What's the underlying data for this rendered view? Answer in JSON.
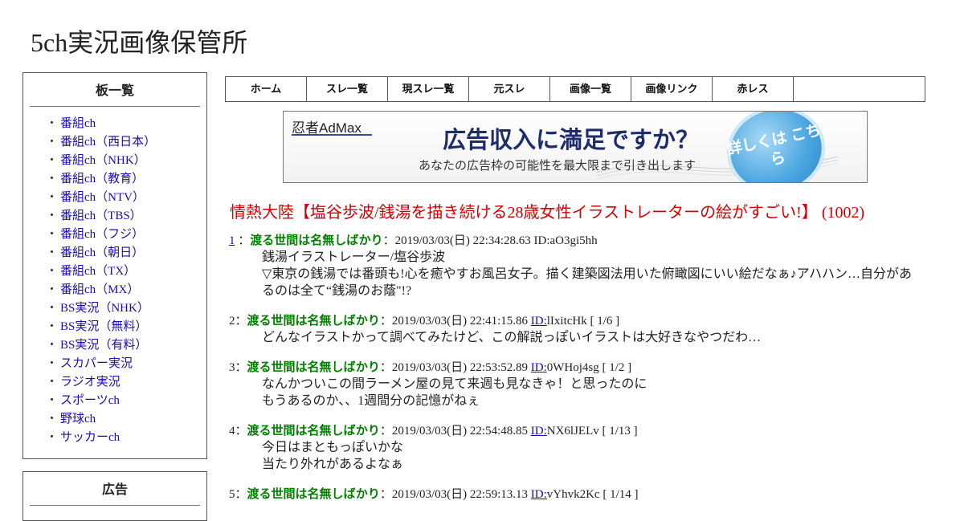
{
  "site": {
    "title": "5ch実況画像保管所"
  },
  "sidebar": {
    "boards_title": "板一覧",
    "bullet": "・",
    "boards": [
      "番組ch",
      "番組ch（西日本）",
      "番組ch（NHK）",
      "番組ch（教育）",
      "番組ch（NTV）",
      "番組ch（TBS）",
      "番組ch（フジ）",
      "番組ch（朝日）",
      "番組ch（TX）",
      "番組ch（MX）",
      "BS実況（NHK）",
      "BS実況（無料）",
      "BS実況（有料）",
      "スカパー実況",
      "ラジオ実況",
      "スポーツch",
      "野球ch",
      "サッカーch"
    ],
    "ad_title": "広告"
  },
  "nav": {
    "tabs": [
      "ホーム",
      "スレ一覧",
      "現スレ一覧",
      "元スレ",
      "画像一覧",
      "画像リンク",
      "赤レス"
    ]
  },
  "banner": {
    "brand": "忍者AdMax",
    "headline": "広告収入に満足ですか？",
    "sub": "あなたの広告枠の可能性を最大限まで引き出します",
    "cta": "詳しくは こちら"
  },
  "thread": {
    "title": "情熱大陸【塩谷歩波/銭湯を描き続ける28歳女性イラストレーターの絵がすごい!】 (1002)"
  },
  "posts": [
    {
      "num": "1",
      "name": "渡る世間は名無しばかり",
      "date": "2019/03/03(日) 22:34:28.63",
      "id_label": "ID:",
      "id_value": "aO3gi5hh",
      "count": "",
      "lines": [
        "銭湯イラストレーター/塩谷歩波",
        "▽東京の銭湯では番頭も!心を癒やすお風呂女子。描く建築図法用いた俯瞰図にいい絵だなぁ♪アハハン…自分があるのは全て“銭湯のお蔭\"!?"
      ]
    },
    {
      "num": "2",
      "name": "渡る世間は名無しばかり",
      "date": "2019/03/03(日) 22:41:15.86",
      "id_label": "ID:",
      "id_value": "lIxitcHk",
      "count": "[ 1/6 ]",
      "lines": [
        "どんなイラストかって調べてみたけど、この解説っぽいイラストは大好きなやつだわ…"
      ]
    },
    {
      "num": "3",
      "name": "渡る世間は名無しばかり",
      "date": "2019/03/03(日) 22:53:52.89",
      "id_label": "ID:",
      "id_value": "0WHoj4sg",
      "count": "[ 1/2 ]",
      "lines": [
        "なんかついこの間ラーメン屋の見て来週も見なきゃ！と思ったのに",
        "もうあるのか、、1週間分の記憶がねぇ"
      ]
    },
    {
      "num": "4",
      "name": "渡る世間は名無しばかり",
      "date": "2019/03/03(日) 22:54:48.85",
      "id_label": "ID:",
      "id_value": "NX6lJELv",
      "count": "[ 1/13 ]",
      "lines": [
        "今日はまともっぽいかな",
        "当たり外れがあるよなぁ"
      ]
    },
    {
      "num": "5",
      "name": "渡る世間は名無しばかり",
      "date": "2019/03/03(日) 22:59:13.13",
      "id_label": "ID:",
      "id_value": "vYhvk2Kc",
      "count": "[ 1/14 ]",
      "lines": []
    }
  ]
}
